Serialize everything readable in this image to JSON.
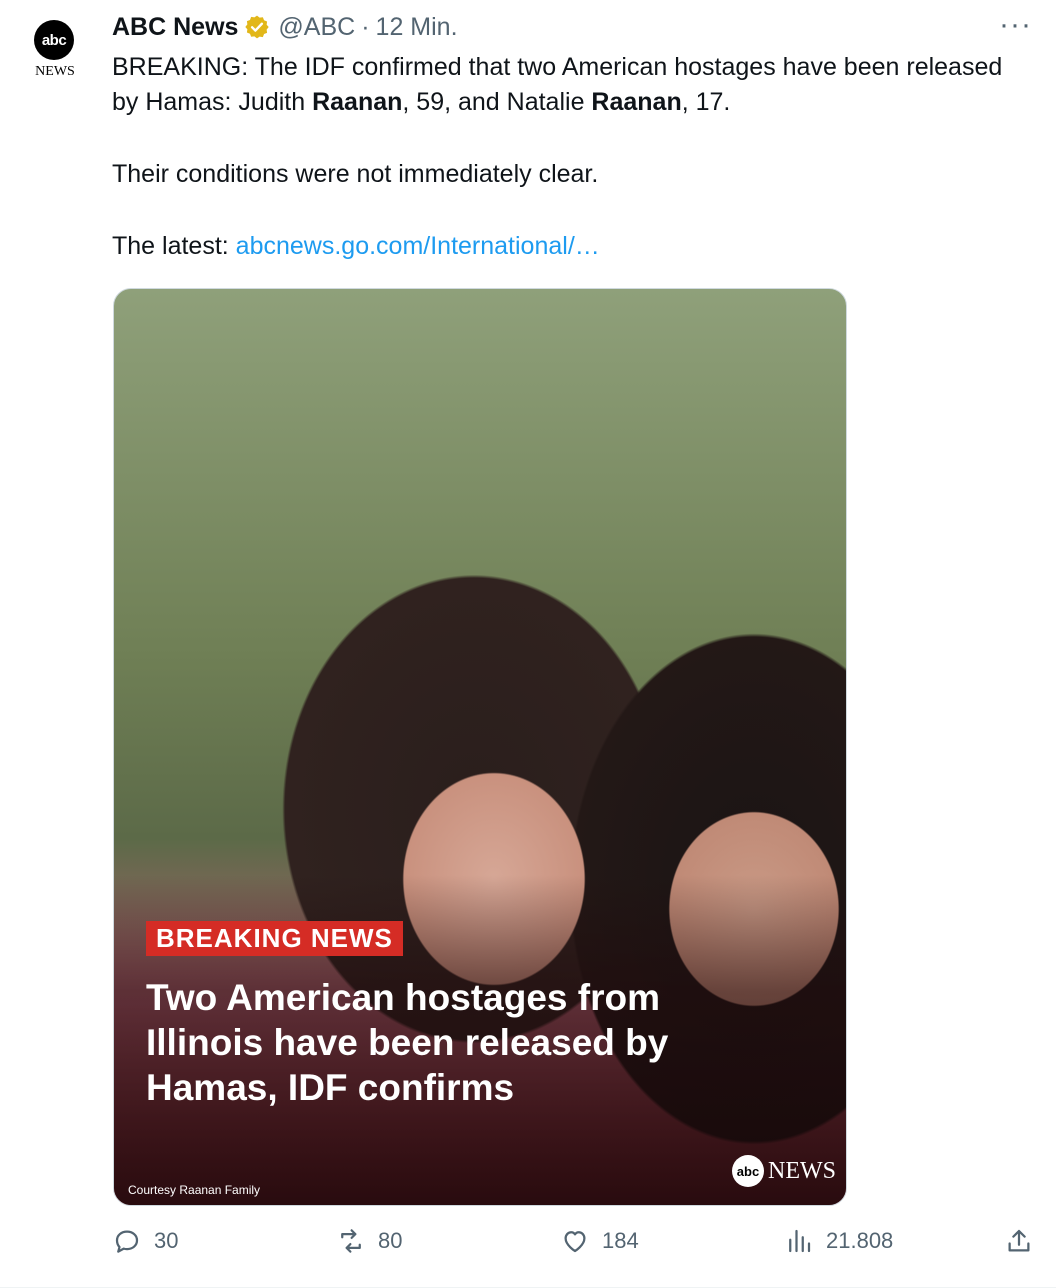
{
  "avatar": {
    "logo_text": "abc",
    "logo_word": "NEWS"
  },
  "header": {
    "name": "ABC News",
    "handle": "@ABC",
    "separator": "·",
    "time": "12 Min.",
    "more": "···"
  },
  "tweet": {
    "line1_pre": "BREAKING: The IDF confirmed that two American hostages have been released by Hamas: Judith ",
    "line1_bold1": "Raanan",
    "line1_mid": ", 59, and Natalie ",
    "line1_bold2": "Raanan",
    "line1_post": ", 17.",
    "para2": "Their conditions were not immediately clear.",
    "latest_label": "The latest: ",
    "latest_link": "abcnews.go.com/International/…"
  },
  "media": {
    "badge": "BREAKING NEWS",
    "headline": "Two American hostages from Illinois have been released by Hamas, IDF confirms",
    "credit": "Courtesy Raanan Family",
    "brand_logo": "abc",
    "brand_word": "NEWS"
  },
  "actions": {
    "replies": "30",
    "reposts": "80",
    "likes": "184",
    "views": "21.808"
  },
  "colors": {
    "link": "#1d9bf0",
    "muted": "#536471",
    "badge": "#d52c25",
    "verified": "#e2b719"
  }
}
